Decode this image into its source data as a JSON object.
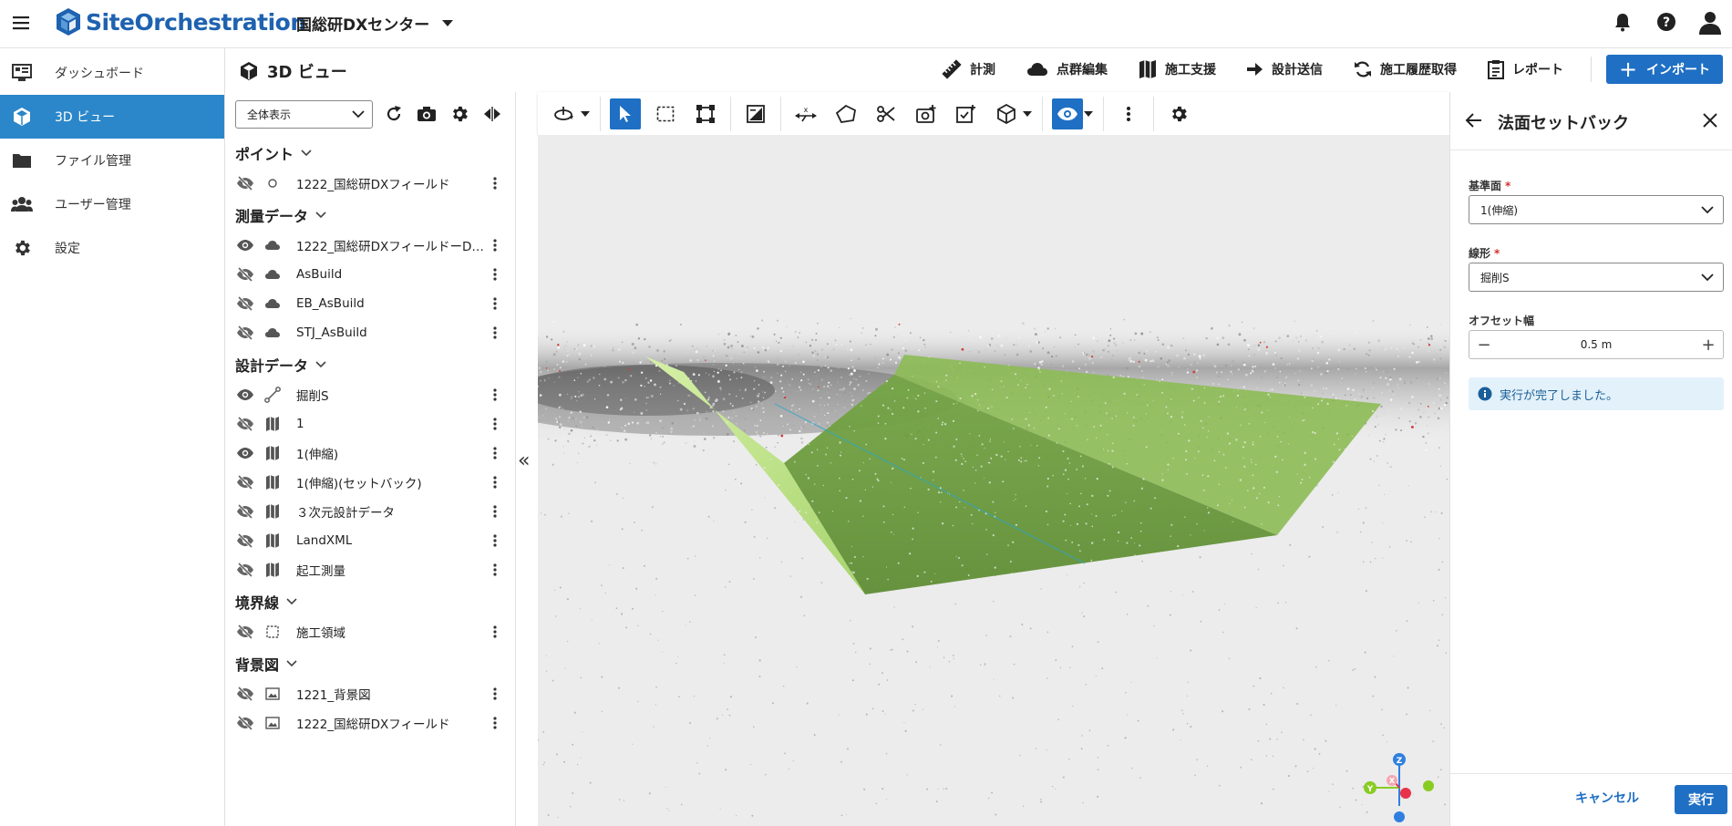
{
  "app": {
    "name": "SiteOrchestration",
    "org": "国総研DXセンター"
  },
  "nav": [
    {
      "label": "ダッシュボード",
      "icon": "dashboard-icon"
    },
    {
      "label": "3D ビュー",
      "icon": "cube-icon",
      "active": true
    },
    {
      "label": "ファイル管理",
      "icon": "folder-icon"
    },
    {
      "label": "ユーザー管理",
      "icon": "users-icon"
    },
    {
      "label": "設定",
      "icon": "gear-icon"
    }
  ],
  "view": {
    "title": "3D ビュー",
    "actions": [
      "計測",
      "点群編集",
      "施工支援",
      "設計送信",
      "施工履歴取得",
      "レポート"
    ],
    "import_label": "インポート"
  },
  "layers": {
    "display_mode": "全体表示",
    "groups": [
      {
        "title": "ポイント",
        "items": [
          {
            "name": "1222_国総研DXフィールド",
            "visible": false,
            "type": "point"
          }
        ]
      },
      {
        "title": "測量データ",
        "items": [
          {
            "name": "1222_国総研DXフィールドーD…",
            "visible": true,
            "type": "cloud"
          },
          {
            "name": "AsBuild",
            "visible": false,
            "type": "cloud"
          },
          {
            "name": "EB_AsBuild",
            "visible": false,
            "type": "cloud"
          },
          {
            "name": "STJ_AsBuild",
            "visible": false,
            "type": "cloud"
          }
        ]
      },
      {
        "title": "設計データ",
        "items": [
          {
            "name": "掘削S",
            "visible": true,
            "type": "line"
          },
          {
            "name": "1",
            "visible": false,
            "type": "map"
          },
          {
            "name": "1(伸縮)",
            "visible": true,
            "type": "map"
          },
          {
            "name": "1(伸縮)(セットバック)",
            "visible": false,
            "type": "map"
          },
          {
            "name": "３次元設計データ",
            "visible": false,
            "type": "map"
          },
          {
            "name": "LandXML",
            "visible": false,
            "type": "map"
          },
          {
            "name": "起工測量",
            "visible": false,
            "type": "map"
          }
        ]
      },
      {
        "title": "境界線",
        "items": [
          {
            "name": "施工領域",
            "visible": false,
            "type": "boundary"
          }
        ]
      },
      {
        "title": "背景図",
        "items": [
          {
            "name": "1221_背景図",
            "visible": false,
            "type": "image"
          },
          {
            "name": "1222_国総研DXフィールド",
            "visible": false,
            "type": "image"
          }
        ]
      }
    ]
  },
  "axes": {
    "z": "Z",
    "y": "Y",
    "x": "X"
  },
  "panel": {
    "title": "法面セットバック",
    "base_label": "基準面",
    "base_value": "1(伸縮)",
    "line_label": "線形",
    "line_value": "掘削S",
    "offset_label": "オフセット幅",
    "offset_value": "0.5 m",
    "message": "実行が完了しました。",
    "cancel_label": "キャンセル",
    "run_label": "実行",
    "required_mark": "*"
  },
  "colors": {
    "primary": "#1f6fc4",
    "nav_active": "#2b87c9",
    "surface": "#6a9a3c"
  }
}
